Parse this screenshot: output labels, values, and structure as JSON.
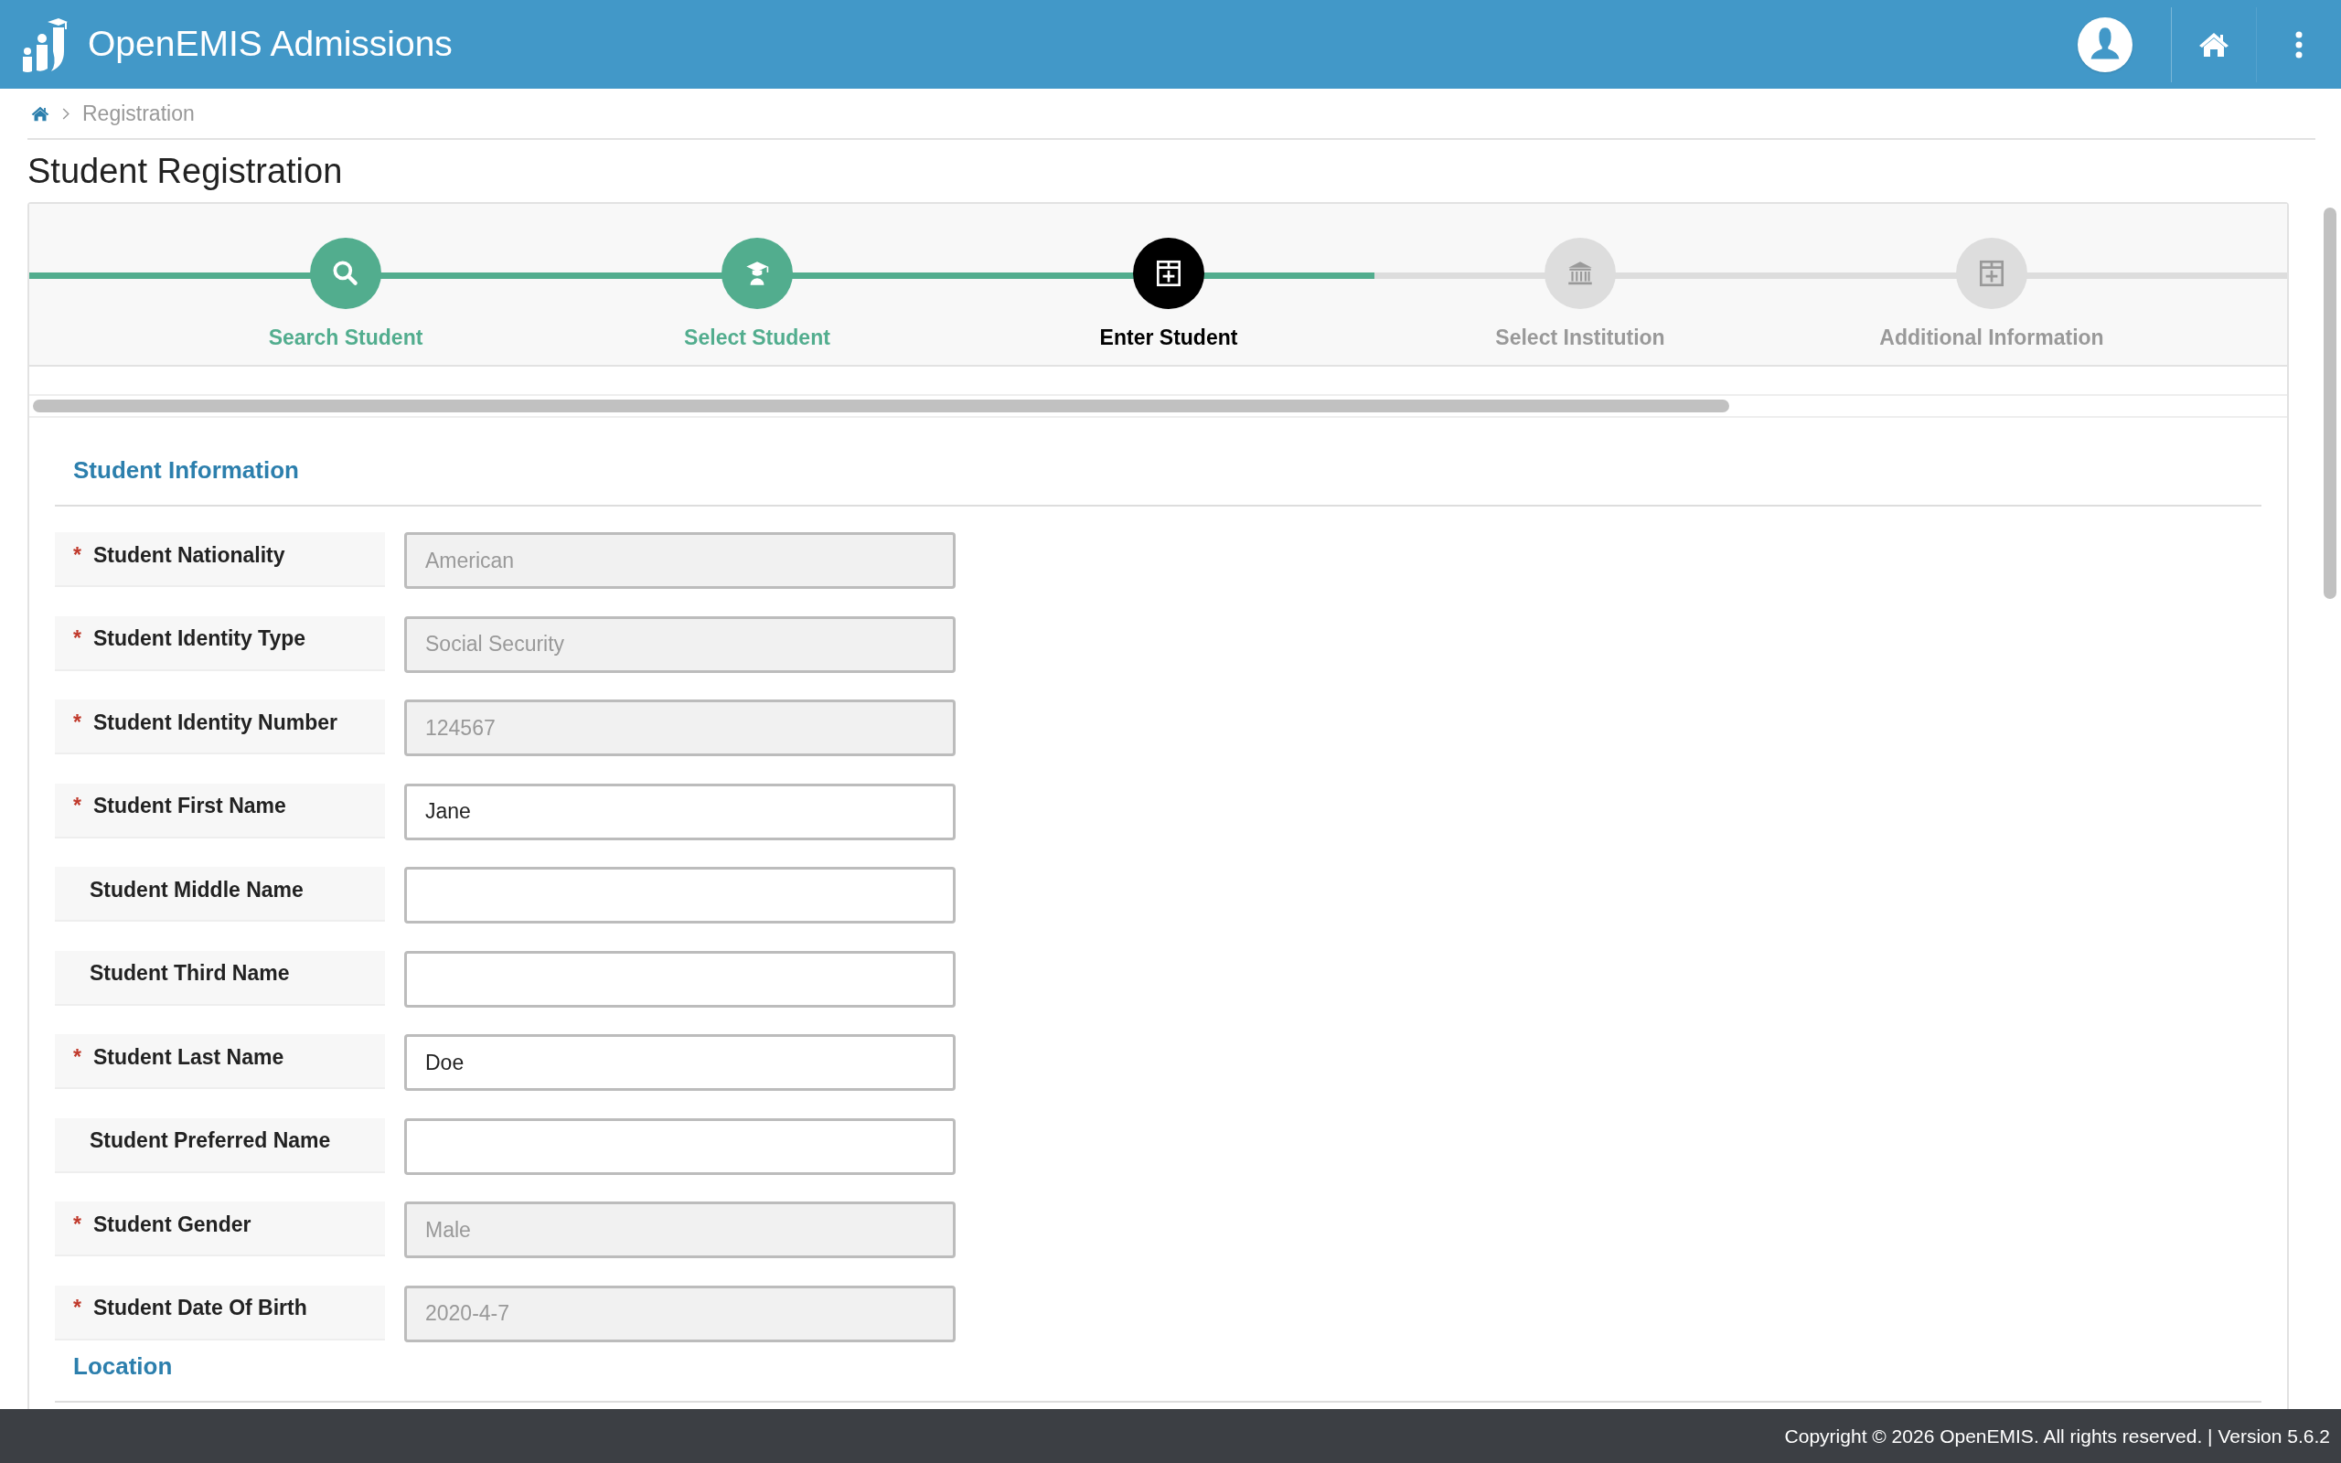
{
  "header": {
    "title": "OpenEMIS Admissions"
  },
  "breadcrumb": {
    "current": "Registration"
  },
  "page_title": "Student Registration",
  "steps": [
    {
      "label": "Search Student",
      "completed": true,
      "selected": false
    },
    {
      "label": "Select Student",
      "completed": true,
      "selected": false
    },
    {
      "label": "Enter Student",
      "completed": false,
      "selected": true
    },
    {
      "label": "Select Institution",
      "completed": false,
      "selected": false
    },
    {
      "label": "Additional Information",
      "completed": false,
      "selected": false
    }
  ],
  "sections": [
    {
      "title": "Student Information",
      "fields": [
        {
          "label": "Student Nationality",
          "required_mark": "*",
          "value": "American",
          "disabled": true
        },
        {
          "label": "Student Identity Type",
          "required_mark": "*",
          "value": "Social Security",
          "disabled": true
        },
        {
          "label": "Student Identity Number",
          "required_mark": "*",
          "value": "124567",
          "disabled": true
        },
        {
          "label": "Student First Name",
          "required_mark": "*",
          "value": "Jane",
          "disabled": false
        },
        {
          "label": "Student Middle Name",
          "disabled": false
        },
        {
          "label": "Student Third Name",
          "disabled": false
        },
        {
          "label": "Student Last Name",
          "required_mark": "*",
          "value": "Doe",
          "disabled": false
        },
        {
          "label": "Student Preferred Name",
          "disabled": false
        },
        {
          "label": "Student Gender",
          "required_mark": "*",
          "value": "Male",
          "disabled": true
        },
        {
          "label": "Student Date Of Birth",
          "required_mark": "*",
          "value": "2020-4-7",
          "disabled": true
        }
      ]
    },
    {
      "title": "Location"
    }
  ],
  "footer": "Copyright © 2026 OpenEMIS. All rights reserved. | Version 5.6.2"
}
